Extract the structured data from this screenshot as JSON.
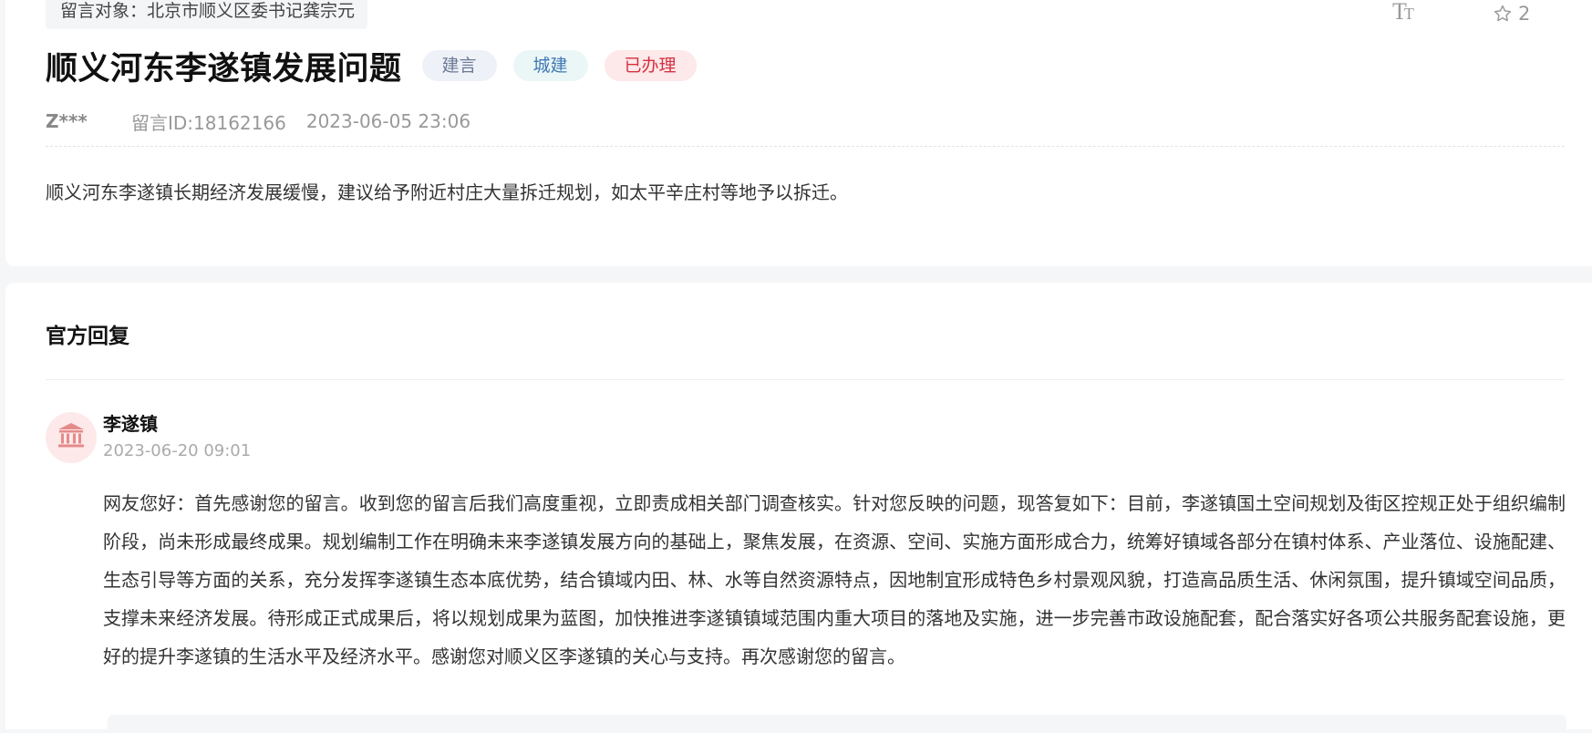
{
  "message": {
    "target_label": "留言对象：北京市顺义区委书记龚宗元",
    "title": "顺义河东李遂镇发展问题",
    "tags": {
      "type": "建言",
      "category": "城建",
      "status": "已办理"
    },
    "author": "Z***",
    "id_label": "留言ID:18162166",
    "time": "2023-06-05 23:06",
    "content": "顺义河东李遂镇长期经济发展缓慢，建议给予附近村庄大量拆迁规划，如太平辛庄村等地予以拆迁。",
    "favorite_count": "2"
  },
  "toolbar": {
    "font_size_icon_big": "T",
    "font_size_icon_small": "T"
  },
  "reply": {
    "heading": "官方回复",
    "replier": "李遂镇",
    "time": "2023-06-20 09:01",
    "body": "网友您好：首先感谢您的留言。收到您的留言后我们高度重视，立即责成相关部门调查核实。针对您反映的问题，现答复如下：目前，李遂镇国土空间规划及街区控规正处于组织编制阶段，尚未形成最终成果。规划编制工作在明确未来李遂镇发展方向的基础上，聚焦发展，在资源、空间、实施方面形成合力，统筹好镇域各部分在镇村体系、产业落位、设施配建、生态引导等方面的关系，充分发挥李遂镇生态本底优势，结合镇域内田、林、水等自然资源特点，因地制宜形成特色乡村景观风貌，打造高品质生活、休闲氛围，提升镇域空间品质，支撑未来经济发展。待形成正式成果后，将以规划成果为蓝图，加快推进李遂镇镇域范围内重大项目的落地及实施，进一步完善市政设施配套，配合落实好各项公共服务配套设施，更好的提升李遂镇的生活水平及经济水平。感谢您对顺义区李遂镇的关心与支持。再次感谢您的留言。"
  },
  "colors": {
    "status_red": "#d6303e",
    "category_blue": "#3f79b5",
    "avatar_icon": "#e58a8a"
  },
  "icons": {
    "font_size": "font-size-icon",
    "favorite": "star-outline-icon",
    "avatar": "government-building-icon"
  }
}
